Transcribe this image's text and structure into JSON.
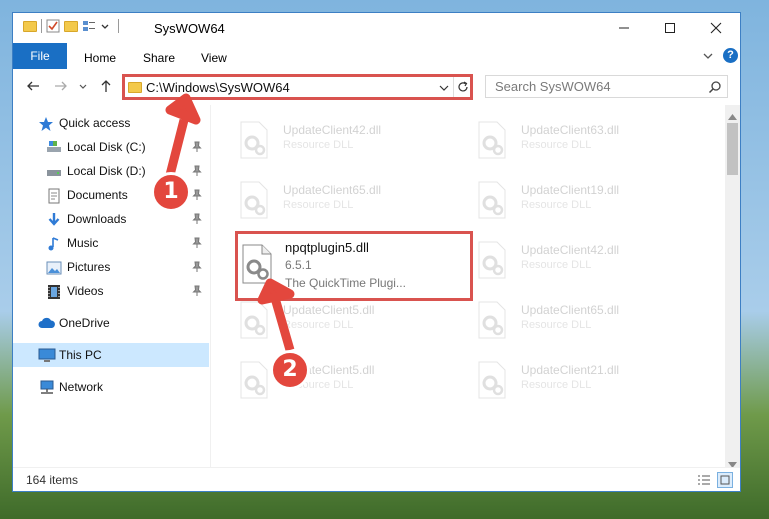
{
  "window": {
    "title": "SysWOW64"
  },
  "ribbon": {
    "file": "File",
    "home": "Home",
    "share": "Share",
    "view": "View"
  },
  "navbar": {
    "address": "C:\\Windows\\SysWOW64",
    "search_placeholder": "Search SysWOW64"
  },
  "sidebar": {
    "quick_access": "Quick access",
    "local_disk_c": "Local Disk (C:)",
    "local_disk_d": "Local Disk (D:)",
    "documents": "Documents",
    "downloads": "Downloads",
    "music": "Music",
    "pictures": "Pictures",
    "videos": "Videos",
    "onedrive": "OneDrive",
    "this_pc": "This PC",
    "network": "Network"
  },
  "files": {
    "f1": {
      "name": "UpdateClient42.dll",
      "desc": "Resource DLL"
    },
    "f2": {
      "name": "UpdateClient63.dll",
      "desc": "Resource DLL"
    },
    "f3": {
      "name": "UpdateClient65.dll",
      "desc": "Resource DLL"
    },
    "f4": {
      "name": "UpdateClient19.dll",
      "desc": "Resource DLL"
    },
    "f5": {
      "name": "npqtplugin5.dll",
      "version": "6.5.1",
      "desc": "The QuickTime Plugi..."
    },
    "f6": {
      "name": "UpdateClient42.dll",
      "desc": "Resource DLL"
    },
    "f7": {
      "name": "UpdateClient5.dll",
      "desc": "Resource DLL"
    },
    "f8": {
      "name": "UpdateClient65.dll",
      "desc": "Resource DLL"
    },
    "f9": {
      "name": "UpdateClient5.dll",
      "desc": "Resource DLL"
    },
    "f10": {
      "name": "UpdateClient21.dll",
      "desc": "Resource DLL"
    }
  },
  "status": {
    "count": "164 items"
  },
  "callouts": {
    "one": "1",
    "two": "2"
  },
  "colors": {
    "accent": "#1a6fc4",
    "highlight": "#d9534f",
    "selected_bg": "#cce8ff"
  }
}
